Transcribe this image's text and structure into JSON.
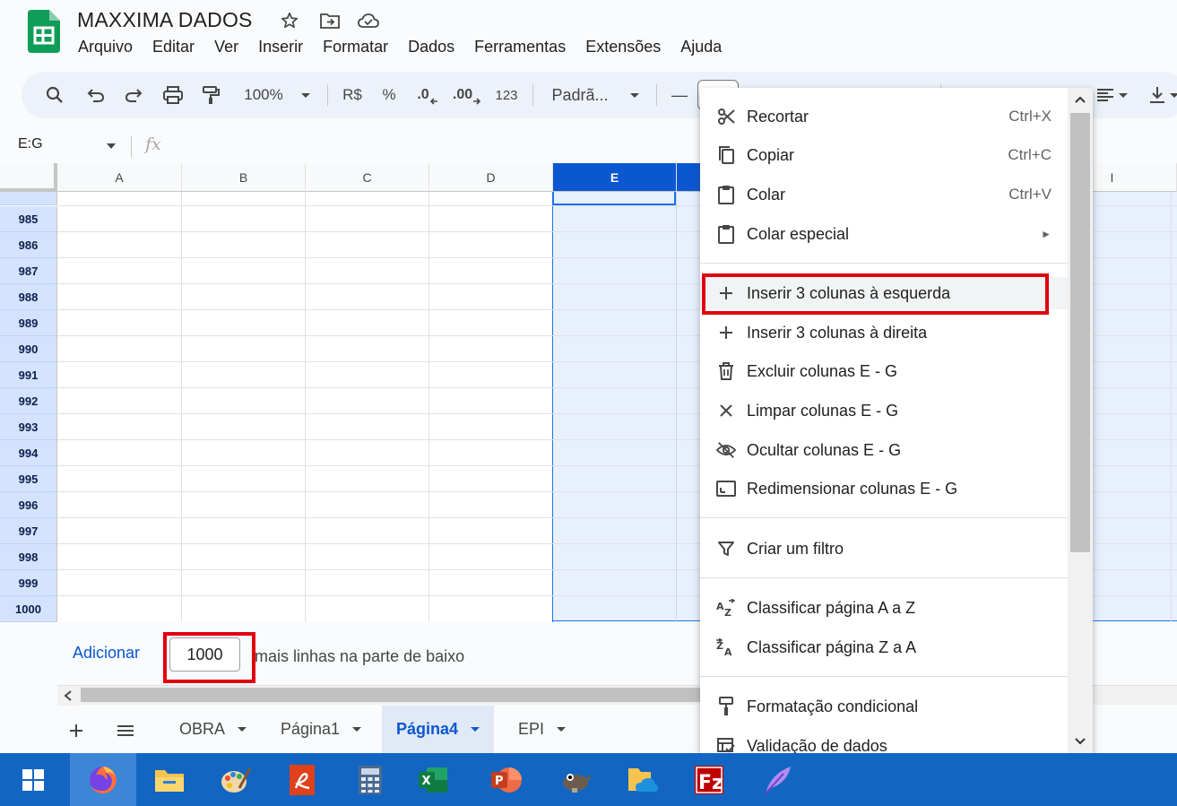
{
  "app": {
    "title": "MAXXIMA DADOS",
    "menu": [
      "Arquivo",
      "Editar",
      "Ver",
      "Inserir",
      "Formatar",
      "Dados",
      "Ferramentas",
      "Extensões",
      "Ajuda"
    ]
  },
  "toolbar": {
    "zoom": "100%",
    "currency": "R$",
    "percent": "%",
    "decimal_decrease": ".0",
    "decimal_increase": ".00",
    "number_format": "123",
    "font": "Padrã...",
    "font_size_minus": "—"
  },
  "formula_bar": {
    "name_box": "E:G",
    "fx": "fx"
  },
  "grid": {
    "columns": [
      "A",
      "B",
      "C",
      "D",
      "E",
      "",
      "",
      "",
      "I"
    ],
    "selected_column": "E",
    "rows": [
      "985",
      "986",
      "987",
      "988",
      "989",
      "990",
      "991",
      "992",
      "993",
      "994",
      "995",
      "996",
      "997",
      "998",
      "999",
      "1000"
    ]
  },
  "add_rows": {
    "button": "Adicionar",
    "count": "1000",
    "suffix": "mais linhas na parte de baixo"
  },
  "sheets": {
    "tabs": [
      "OBRA",
      "Página1",
      "Página4",
      "EPI"
    ],
    "active": "Página4"
  },
  "context_menu": {
    "items": [
      {
        "label": "Recortar",
        "shortcut": "Ctrl+X"
      },
      {
        "label": "Copiar",
        "shortcut": "Ctrl+C"
      },
      {
        "label": "Colar",
        "shortcut": "Ctrl+V"
      },
      {
        "label": "Colar especial",
        "shortcut": "►"
      },
      {
        "label": "Inserir 3 colunas à esquerda",
        "shortcut": ""
      },
      {
        "label": "Inserir 3 colunas à direita",
        "shortcut": ""
      },
      {
        "label": "Excluir colunas E - G",
        "shortcut": ""
      },
      {
        "label": "Limpar colunas E - G",
        "shortcut": ""
      },
      {
        "label": "Ocultar colunas E - G",
        "shortcut": ""
      },
      {
        "label": "Redimensionar colunas E - G",
        "shortcut": ""
      },
      {
        "label": "Criar um filtro",
        "shortcut": ""
      },
      {
        "label": "Classificar página A a Z",
        "shortcut": ""
      },
      {
        "label": "Classificar página Z a A",
        "shortcut": ""
      },
      {
        "label": "Formatação condicional",
        "shortcut": ""
      },
      {
        "label": "Validação de dados",
        "shortcut": ""
      }
    ]
  },
  "colors": {
    "accent": "#0b57d0",
    "selection": "#e8f0fe",
    "highlight_box": "#e1000f",
    "taskbar": "#1266c2"
  },
  "taskbar": {
    "icons": [
      "windows-start-icon",
      "firefox-icon",
      "file-explorer-icon",
      "paint-icon",
      "pdf-app-icon",
      "calculator-icon",
      "excel-icon",
      "powerpoint-icon",
      "gimp-icon",
      "onedrive-folder-icon",
      "filezilla-icon",
      "feather-app-icon"
    ]
  }
}
